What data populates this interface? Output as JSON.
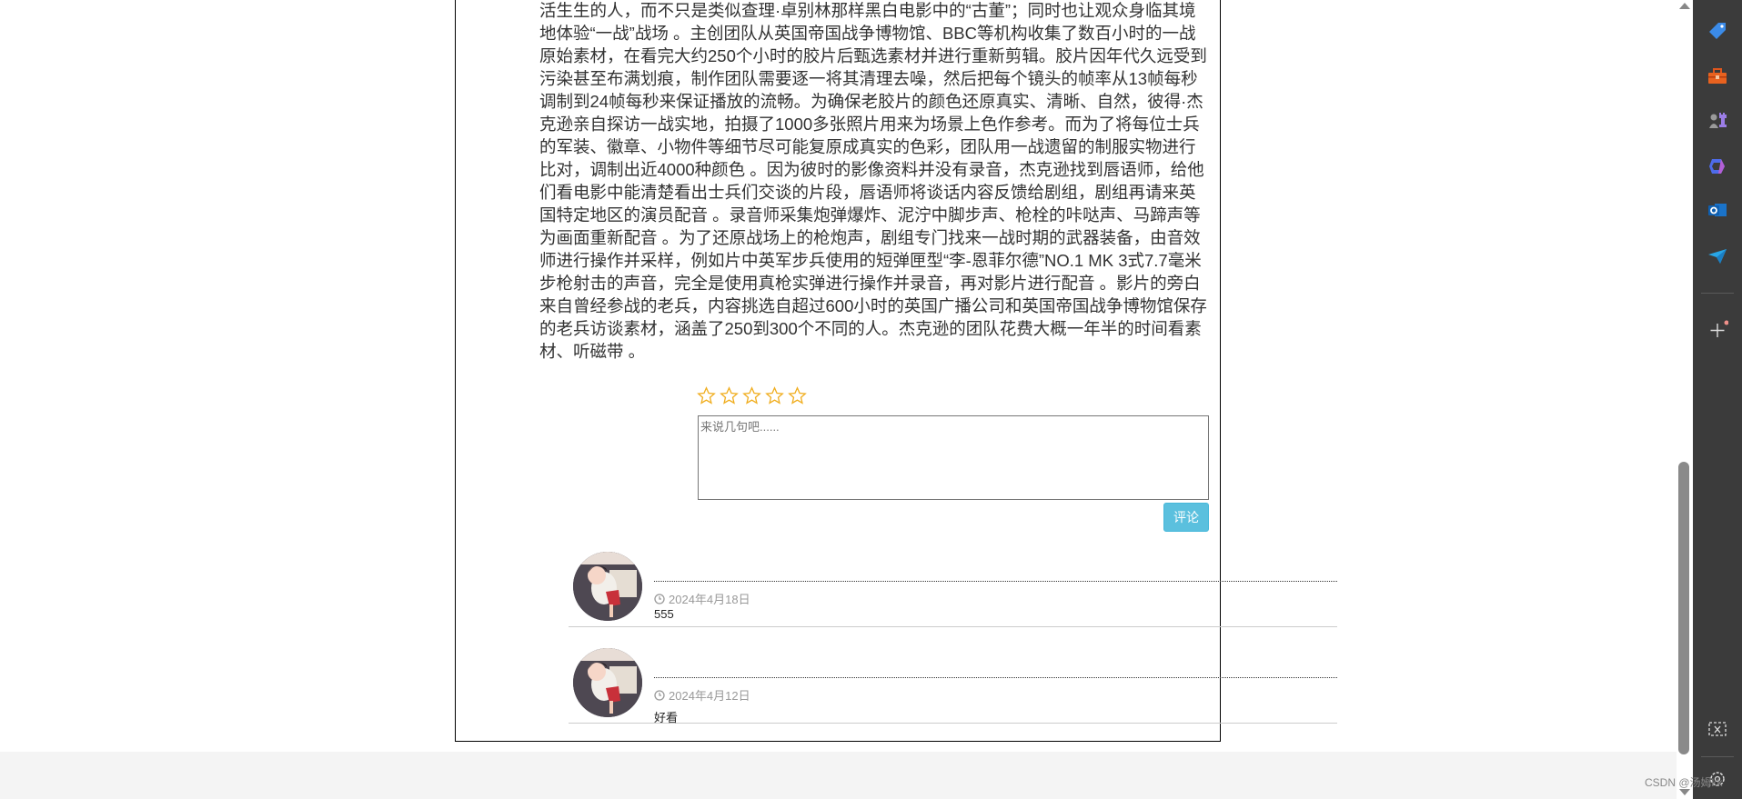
{
  "article": {
    "lines": [
      "活生生的人，而不只是类似查理·卓别林那样黑白电影中的“古董”；同时也让观众身临其境",
      "地体验“一战”战场 。主创团队从英国帝国战争博物馆、BBC等机构收集了数百小时的一战",
      "原始素材，在看完大约250个小时的胶片后甄选素材并进行重新剪辑。胶片因年代久远受到",
      "污染甚至布满划痕，制作团队需要逐一将其清理去噪，然后把每个镜头的帧率从13帧每秒",
      "调制到24帧每秒来保证播放的流畅。为确保老胶片的颜色还原真实、清晰、自然，彼得·杰",
      "克逊亲自探访一战实地，拍摄了1000多张照片用来为场景上色作参考。而为了将每位士兵",
      "的军装、徽章、小物件等细节尽可能复原成真实的色彩，团队用一战遗留的制服实物进行",
      "比对，调制出近4000种颜色 。因为彼时的影像资料并没有录音，杰克逊找到唇语师，给他",
      "们看电影中能清楚看出士兵们交谈的片段，唇语师将谈话内容反馈给剧组，剧组再请来英",
      "国特定地区的演员配音 。录音师采集炮弹爆炸、泥泞中脚步声、枪栓的咔哒声、马蹄声等",
      "为画面重新配音 。为了还原战场上的枪炮声，剧组专门找来一战时期的武器装备，由音效",
      "师进行操作并采样，例如片中英军步兵使用的短弹匣型“李-恩菲尔德”NO.1 MK 3式7.7毫米",
      "步枪射击的声音，完全是使用真枪实弹进行操作并录音，再对影片进行配音 。影片的旁白",
      "来自曾经参战的老兵，内容挑选自超过600小时的英国广播公司和英国帝国战争博物馆保存",
      "的老兵访谈素材，涵盖了250到300个不同的人。杰克逊的团队花费大概一年半的时间看素",
      "材、听磁带 。"
    ]
  },
  "rating": {
    "max": 5,
    "value": 0,
    "color": "#f0ad1e"
  },
  "comment_form": {
    "placeholder": "来说几句吧......",
    "value": "",
    "submit_label": "评论",
    "button_color": "#5bc0de"
  },
  "comments": [
    {
      "date": "2024年4月18日",
      "text": "555"
    },
    {
      "date": "2024年4月12日",
      "text": "好看"
    }
  ],
  "sidebar": {
    "icons": [
      "tag-icon",
      "toolbox-icon",
      "chess-icon",
      "copilot-icon",
      "outlook-icon",
      "send-icon",
      "add-icon",
      "screenshot-icon",
      "settings-icon"
    ]
  },
  "watermark": "CSDN @汤姆kk"
}
